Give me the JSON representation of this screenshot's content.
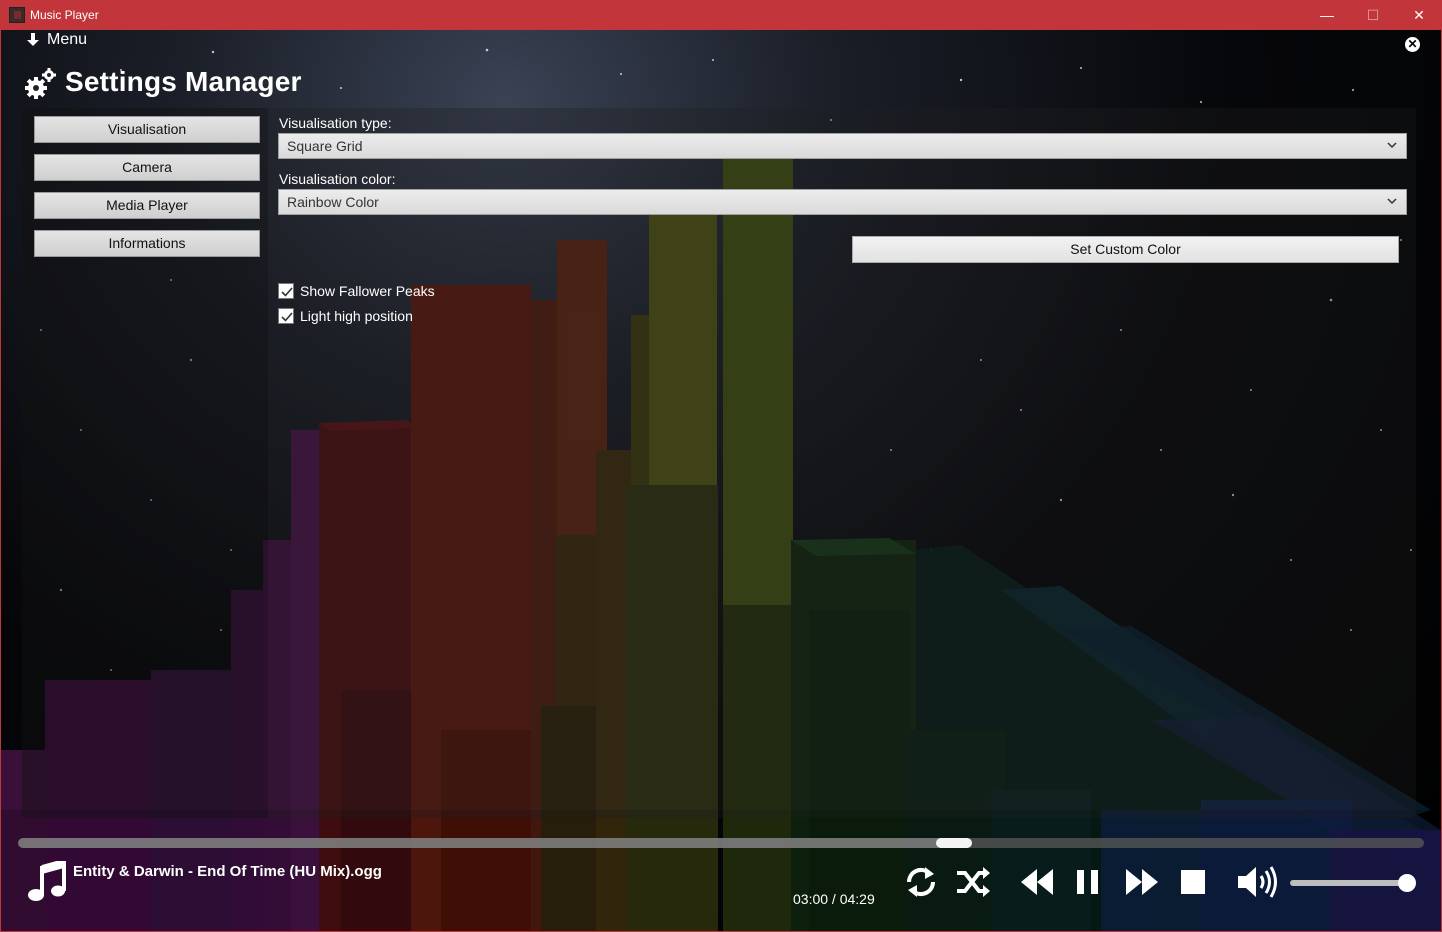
{
  "window": {
    "title": "Music Player",
    "minimize_glyph": "—",
    "maximize_glyph": "☐",
    "close_glyph": "✕"
  },
  "menu": {
    "label": "Menu",
    "icon": "arrow-down-icon"
  },
  "overlay": {
    "close_glyph": "✕"
  },
  "header": {
    "title": "Settings Manager",
    "icon": "gears-icon"
  },
  "sidebar": {
    "items": [
      {
        "label": "Visualisation"
      },
      {
        "label": "Camera"
      },
      {
        "label": "Media Player"
      },
      {
        "label": "Informations"
      }
    ]
  },
  "settings": {
    "vis_type_label": "Visualisation type:",
    "vis_type_value": "Square Grid",
    "vis_color_label": "Visualisation color:",
    "vis_color_value": "Rainbow Color",
    "custom_color_button": "Set Custom Color",
    "checkboxes": [
      {
        "label": "Show Fallower Peaks",
        "checked": true
      },
      {
        "label": "Light high position",
        "checked": true
      }
    ]
  },
  "player": {
    "track": "Entity & Darwin - End Of Time (HU Mix).ogg",
    "time": "03:00 / 04:29",
    "progress": 0.67,
    "volume": 1.0,
    "controls": [
      "repeat-icon",
      "shuffle-icon",
      "rewind-icon",
      "pause-icon",
      "fast-forward-icon",
      "stop-icon",
      "volume-icon"
    ]
  },
  "colors": {
    "titlebar": "#c2353b",
    "accent": "#ffffff"
  }
}
